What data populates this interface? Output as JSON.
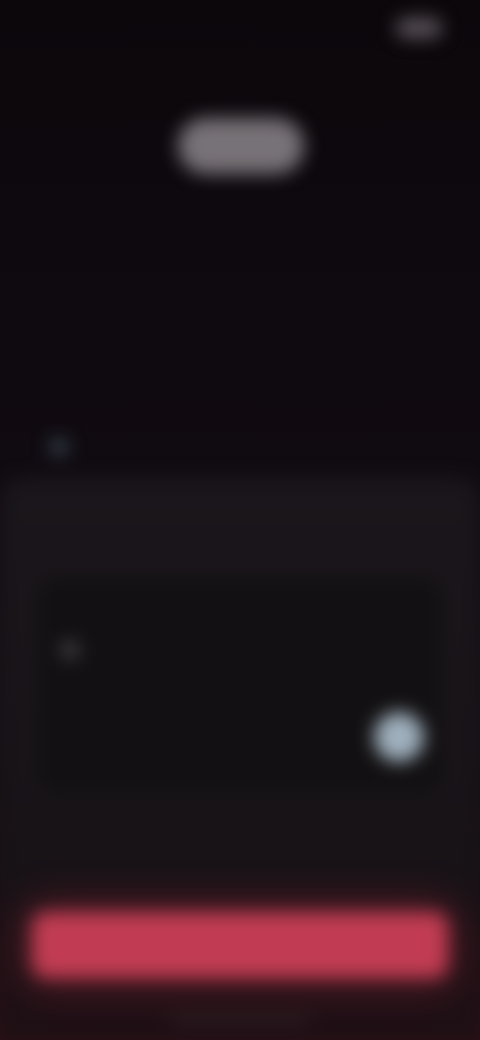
{
  "status_bar": {
    "time": "",
    "battery_icon": "battery-icon"
  },
  "page": {
    "title": ""
  },
  "tabs": [
    {
      "label": ""
    },
    {
      "label": ""
    },
    {
      "label": "",
      "active": true
    },
    {
      "label": ""
    },
    {
      "label": ""
    }
  ],
  "background_lines": [
    {
      "text": ""
    },
    {
      "text": ""
    },
    {
      "text": ""
    },
    {
      "text": ""
    }
  ],
  "sheet": {
    "title": "",
    "card": {
      "label": "",
      "value_right": "",
      "line": "",
      "sub_label": "",
      "sub_text": "",
      "toggle_on": true
    },
    "secondary_link": "",
    "primary_button": ""
  },
  "colors": {
    "accent": "#c13c52",
    "toggle": "#9fb0bd",
    "background": "#0d090d"
  }
}
